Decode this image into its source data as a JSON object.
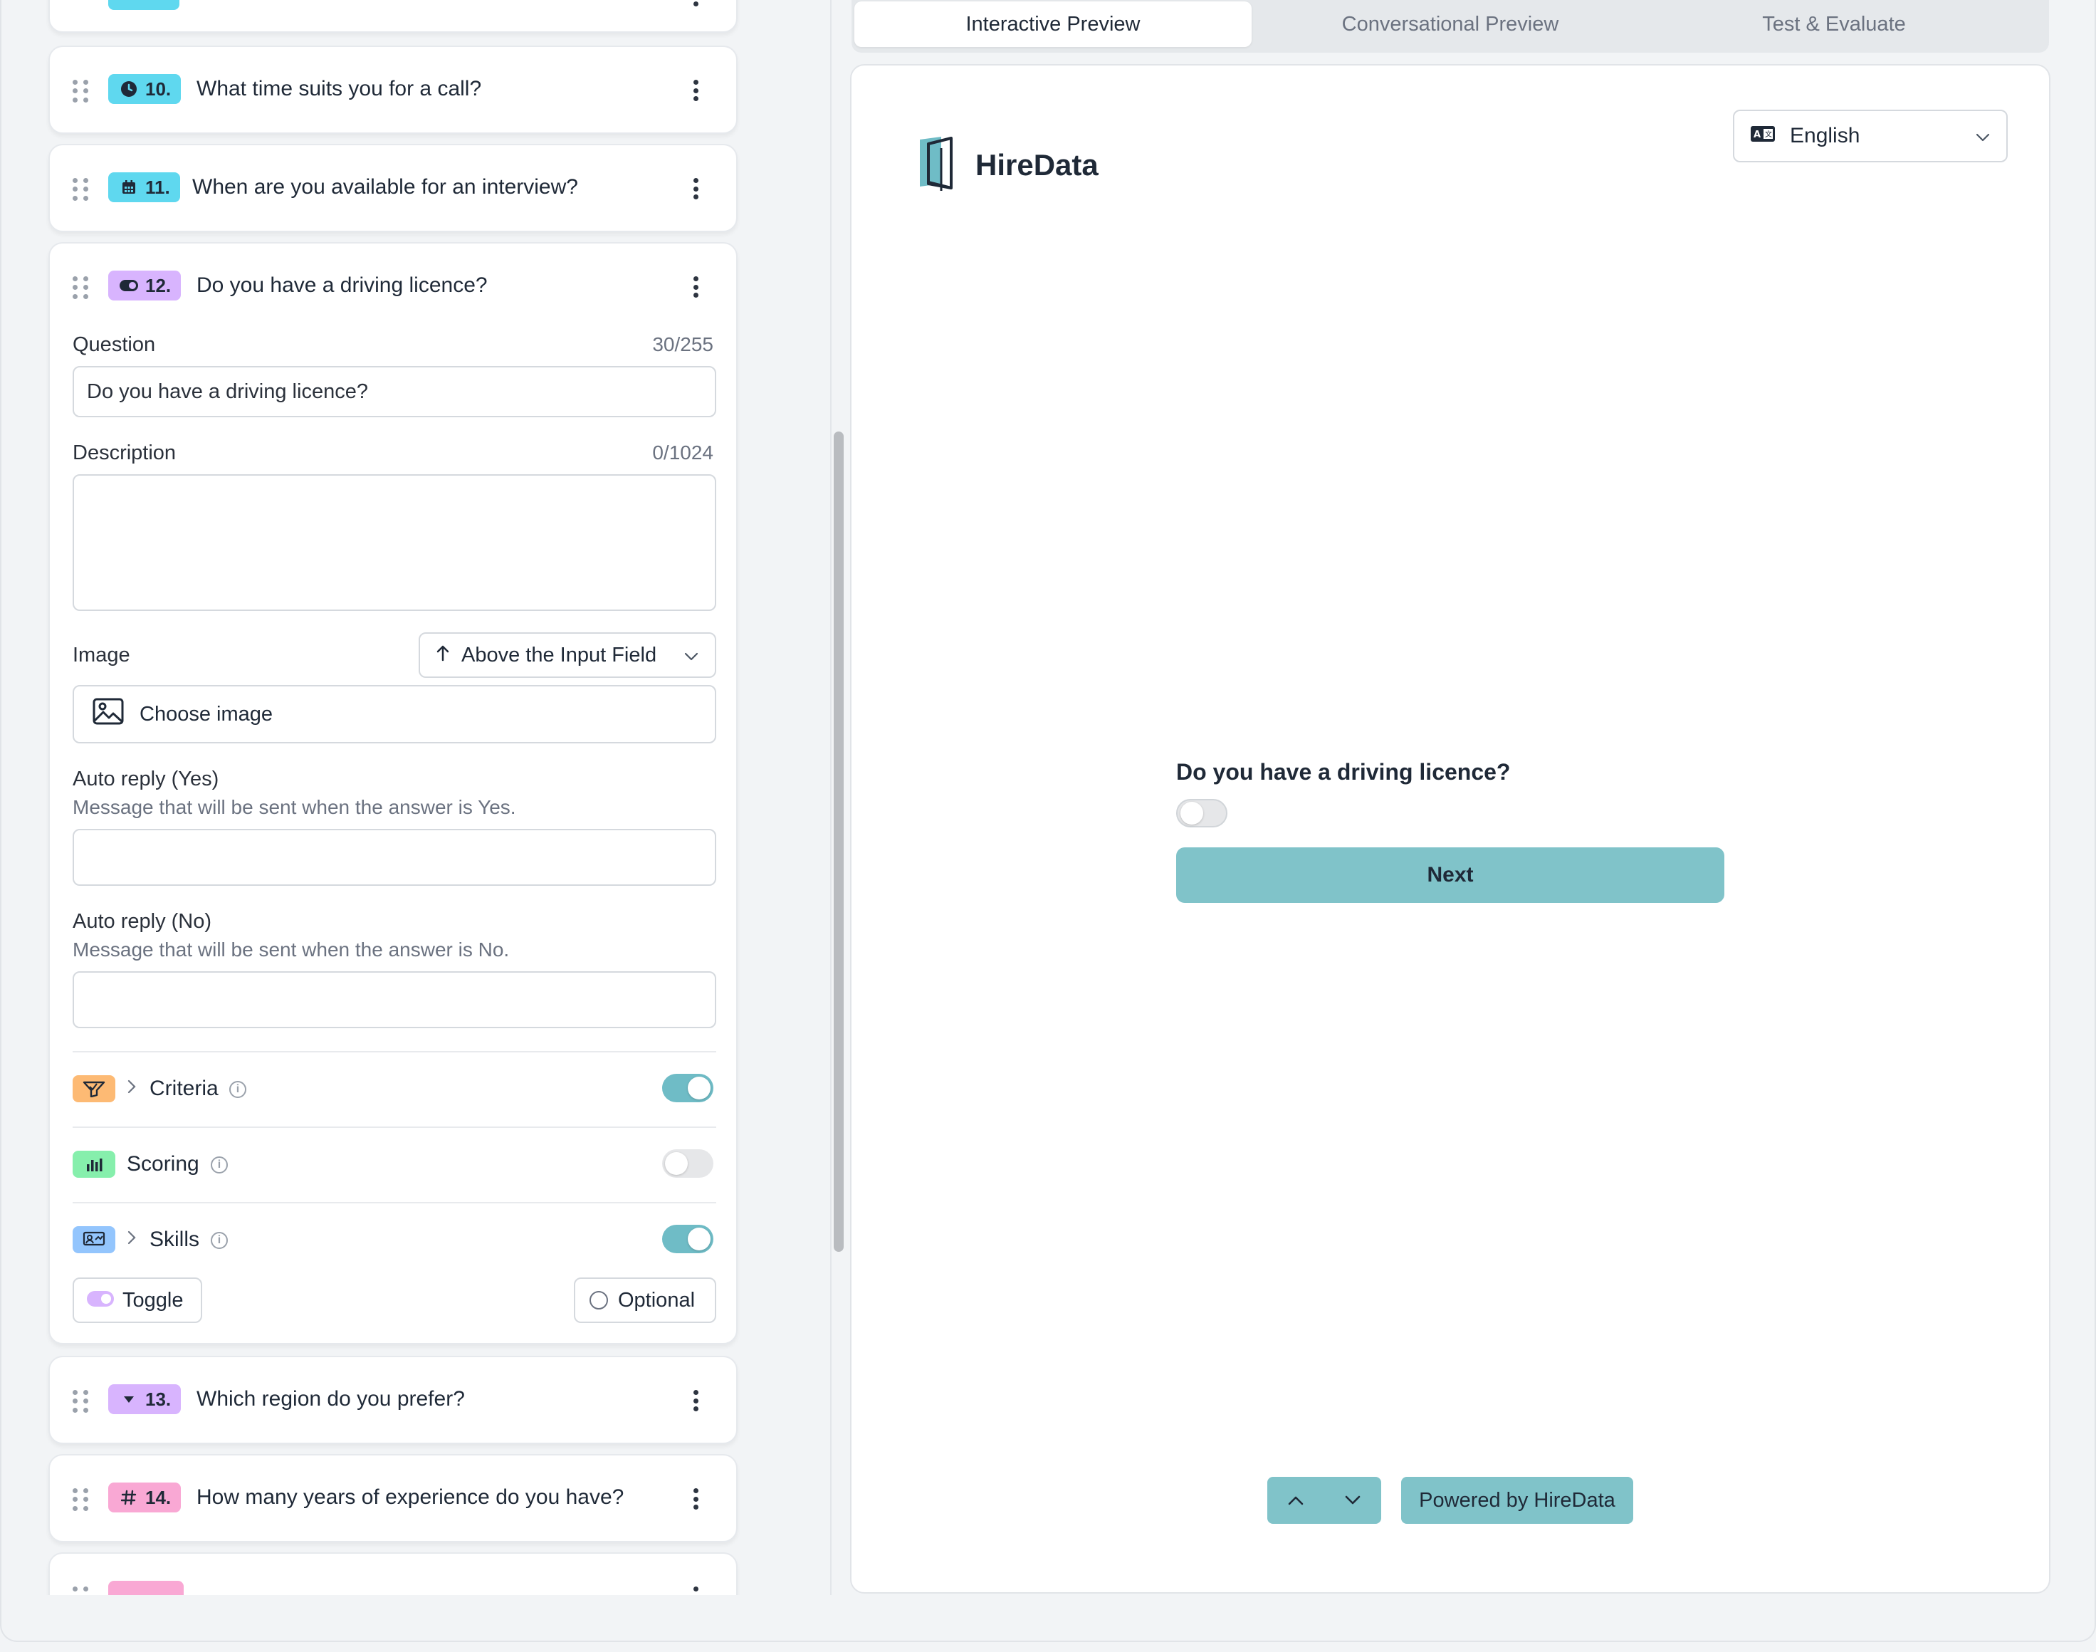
{
  "tabs": {
    "interactive": "Interactive Preview",
    "conversational": "Conversational Preview",
    "test": "Test & Evaluate"
  },
  "questions": [
    {
      "number": "10.",
      "title": "What time suits you for a call?",
      "type_icon": "clock-icon",
      "badge_color": "#5fd8ef"
    },
    {
      "number": "11.",
      "title": "When are you available for an interview?",
      "type_icon": "calendar-icon",
      "badge_color": "#5fd8ef"
    },
    {
      "number": "12.",
      "title": "Do you have a driving licence?",
      "type_icon": "toggle-icon",
      "badge_color": "#d8b4fe"
    },
    {
      "number": "13.",
      "title": "Which region do you prefer?",
      "type_icon": "dropdown-icon",
      "badge_color": "#d8b4fe"
    },
    {
      "number": "14.",
      "title": "How many years of experience do you have?",
      "type_icon": "hash-icon",
      "badge_color": "#f9a8d4"
    }
  ],
  "editor": {
    "question_label": "Question",
    "question_count": "30/255",
    "question_value": "Do you have a driving licence?",
    "description_label": "Description",
    "description_count": "0/1024",
    "description_value": "",
    "image_label": "Image",
    "image_position": "Above the Input Field",
    "choose_image": "Choose image",
    "auto_yes_label": "Auto reply (Yes)",
    "auto_yes_sub": "Message that will be sent when the answer is Yes.",
    "auto_no_label": "Auto reply (No)",
    "auto_no_sub": "Message that will be sent when the answer is No.",
    "criteria_label": "Criteria",
    "criteria_enabled": true,
    "scoring_label": "Scoring",
    "scoring_enabled": false,
    "skills_label": "Skills",
    "skills_enabled": true,
    "type_button": "Toggle",
    "optional_button": "Optional"
  },
  "preview": {
    "brand": "HireData",
    "language": "English",
    "question": "Do you have a driving licence?",
    "answer_on": false,
    "next_button": "Next",
    "powered_by": "Powered by HireData"
  },
  "colors": {
    "accent": "#80c3c9",
    "toggle_on": "#6fbcc6",
    "criteria_icon_bg": "#fdba74",
    "scoring_icon_bg": "#86efac",
    "skills_icon_bg": "#93c5fd"
  }
}
